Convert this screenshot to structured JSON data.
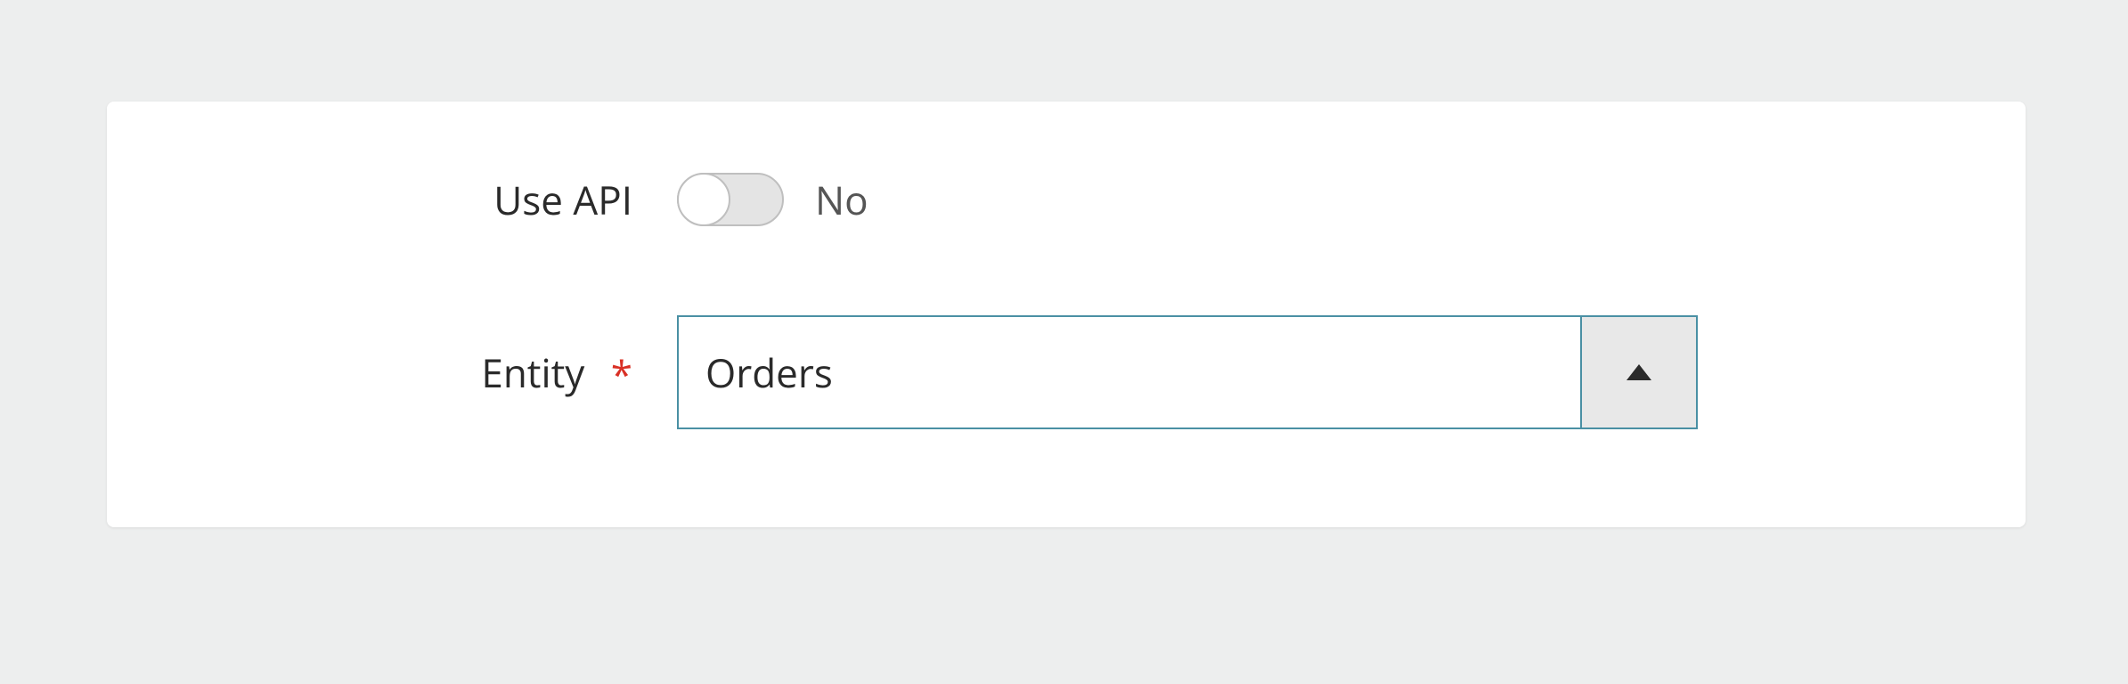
{
  "form": {
    "use_api": {
      "label": "Use API",
      "state_label": "No",
      "enabled": false
    },
    "entity": {
      "label": "Entity",
      "required_marker": "*",
      "selected": "Orders"
    }
  }
}
